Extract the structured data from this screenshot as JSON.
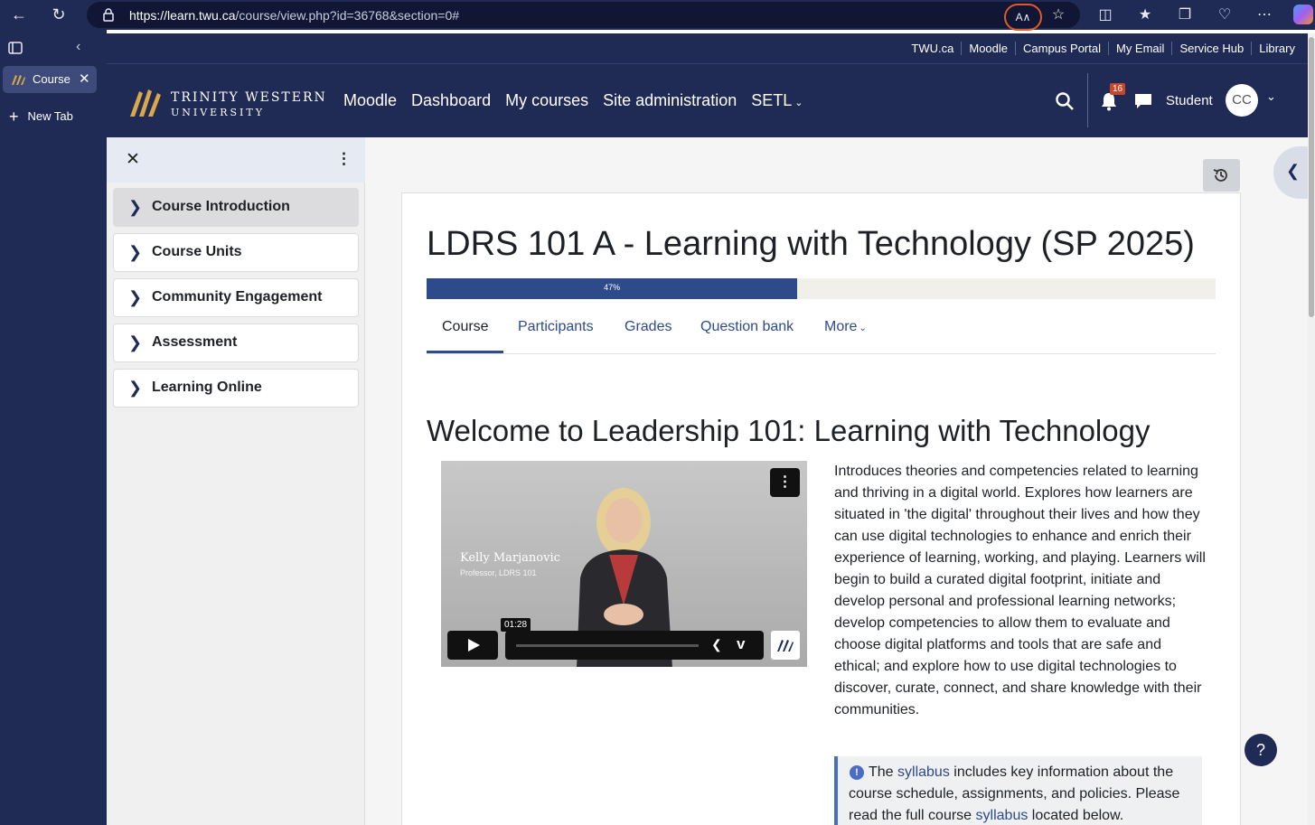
{
  "browser": {
    "url_host": "https://learn.twu.ca",
    "url_path": "/course/view.php?id=36768&section=0#",
    "tab_label": "Course",
    "new_tab_label": "New Tab"
  },
  "utility_links": [
    "TWU.ca",
    "Moodle",
    "Campus Portal",
    "My Email",
    "Service Hub",
    "Library"
  ],
  "header": {
    "logo_line1": "TRINITY WESTERN",
    "logo_line2": "UNIVERSITY",
    "nav": [
      "Moodle",
      "Dashboard",
      "My courses",
      "Site administration",
      "SETL"
    ],
    "notification_count": "16",
    "user_label": "Student",
    "avatar_initials": "CC"
  },
  "course_index": {
    "sections": [
      "Course Introduction",
      "Course Units",
      "Community Engagement",
      "Assessment",
      "Learning Online"
    ],
    "active_index": 0
  },
  "course": {
    "title": "LDRS 101 A - Learning with Technology (SP 2025)",
    "progress_percent": 47,
    "progress_label": "47%",
    "tabs": [
      "Course",
      "Participants",
      "Grades",
      "Question bank",
      "More"
    ],
    "active_tab": "Course"
  },
  "welcome_heading": "Welcome to Leadership 101: Learning with Technology",
  "video": {
    "presenter_name": "Kelly Marjanovic",
    "presenter_role": "Professor, LDRS 101",
    "timestamp": "01:28"
  },
  "description": "Introduces theories and competencies related to learning and thriving in a digital world. Explores how learners are situated in 'the digital' throughout their lives and how they can use digital technologies to enhance and enrich their experience of learning, working, and playing. Learners will begin to build a curated digital footprint, initiate and develop personal and professional learning networks; develop competencies to allow them to evaluate and choose digital platforms and tools that are safe and ethical; and explore how to use digital technologies to discover, curate, connect, and share knowledge with their communities.",
  "notice": {
    "t1": "The ",
    "link1": "syllabus",
    "t2": " includes key information about the course schedule, assignments, and policies. Please read the full course ",
    "link2": "syllabus",
    "t3": " located below."
  },
  "help_label": "?",
  "colors": {
    "brand_navy": "#1f2a55",
    "progress_fill": "#2d4a8a",
    "link": "#2d4a8a",
    "badge": "#c8462b"
  }
}
